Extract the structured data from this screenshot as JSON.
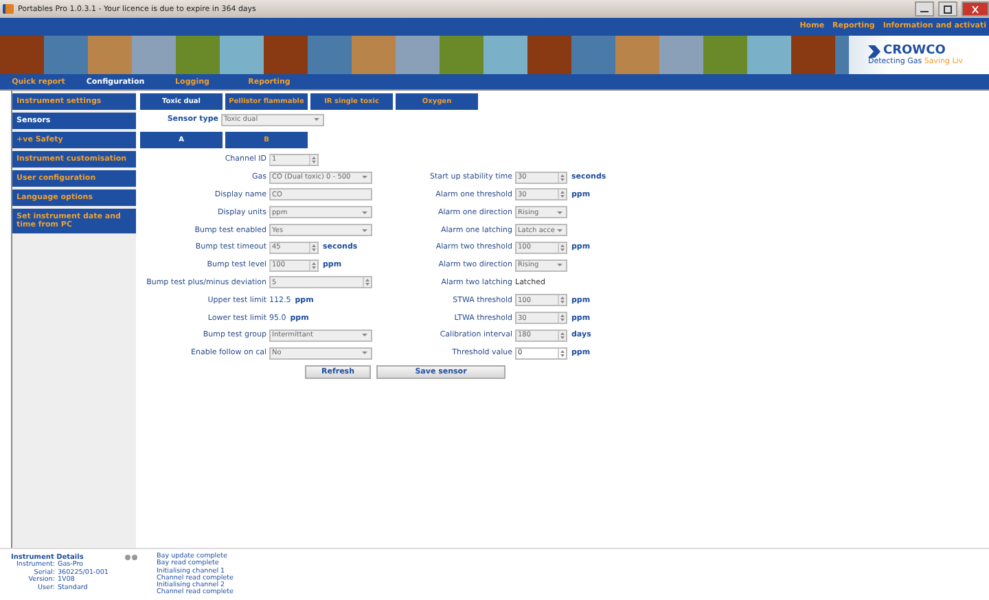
{
  "window": {
    "title": "Portables Pro 1.0.3.1 - Your licence is due to expire in 364 days"
  },
  "top_links": [
    "Home",
    "Reporting",
    "Information and activati"
  ],
  "logo": {
    "name": "CROWCO",
    "tagline_a": "Detecting Gas",
    "tagline_b": "Saving Liv"
  },
  "menu": [
    {
      "label": "Quick report",
      "selected": false
    },
    {
      "label": "Configuration",
      "selected": true
    },
    {
      "label": "Logging",
      "selected": false
    },
    {
      "label": "Reporting",
      "selected": false
    }
  ],
  "sidebar": [
    {
      "label": "Instrument settings",
      "selected": false
    },
    {
      "label": "Sensors",
      "selected": true
    },
    {
      "label": "+ve Safety",
      "selected": false
    },
    {
      "label": "Instrument customisation",
      "selected": false
    },
    {
      "label": "User configuration",
      "selected": false
    },
    {
      "label": "Language options",
      "selected": false
    },
    {
      "label": "Set instrument date and time from PC",
      "selected": false
    }
  ],
  "sensor_tabs": [
    {
      "label": "Toxic dual",
      "selected": true
    },
    {
      "label": "Pellistor flammable",
      "selected": false
    },
    {
      "label": "IR single toxic",
      "selected": false
    },
    {
      "label": "Oxygen",
      "selected": false
    }
  ],
  "sensor_type": {
    "label": "Sensor type",
    "value": "Toxic dual"
  },
  "channel_tabs": [
    {
      "label": "A",
      "selected": true
    },
    {
      "label": "B",
      "selected": false
    }
  ],
  "left_fields": [
    {
      "label": "Channel ID",
      "kind": "spin",
      "value": "1",
      "disabled": true
    },
    {
      "label": "Gas",
      "kind": "select",
      "value": "CO (Dual toxic) 0 - 500",
      "disabled": true
    },
    {
      "label": "Display name",
      "kind": "text",
      "value": "CO",
      "disabled": true
    },
    {
      "label": "Display units",
      "kind": "select",
      "value": "ppm",
      "disabled": true
    },
    {
      "label": "Bump test enabled",
      "kind": "select",
      "value": "Yes",
      "disabled": true
    },
    {
      "label": "Bump test timeout",
      "kind": "spin",
      "value": "45",
      "disabled": true,
      "unit": "seconds"
    },
    {
      "label": "Bump test level",
      "kind": "spin",
      "value": "100",
      "disabled": true,
      "unit": "ppm"
    },
    {
      "label": "Bump test plus/minus deviation",
      "kind": "widespin",
      "value": "5",
      "disabled": true
    },
    {
      "label": "Upper test limit",
      "kind": "static",
      "value": "112.5",
      "unit": "ppm"
    },
    {
      "label": "Lower test limit",
      "kind": "static",
      "value": "95.0",
      "unit": "ppm"
    },
    {
      "label": "Bump test group",
      "kind": "select",
      "value": "Intermittant",
      "disabled": true
    },
    {
      "label": "Enable follow on cal",
      "kind": "select",
      "value": "No",
      "disabled": true
    }
  ],
  "right_fields": [
    {
      "label": "Start up stability time",
      "kind": "spin",
      "value": "30",
      "disabled": true,
      "unit": "seconds"
    },
    {
      "label": "Alarm one threshold",
      "kind": "spin",
      "value": "30",
      "disabled": true,
      "unit": "ppm"
    },
    {
      "label": "Alarm one direction",
      "kind": "select",
      "value": "Rising",
      "disabled": true
    },
    {
      "label": "Alarm one latching",
      "kind": "select",
      "value": "Latch acce",
      "disabled": true
    },
    {
      "label": "Alarm two threshold",
      "kind": "spin",
      "value": "100",
      "disabled": true,
      "unit": "ppm"
    },
    {
      "label": "Alarm two direction",
      "kind": "select",
      "value": "Rising",
      "disabled": true
    },
    {
      "label": "Alarm two latching",
      "kind": "static",
      "value": "Latched"
    },
    {
      "label": "STWA threshold",
      "kind": "spin",
      "value": "100",
      "disabled": true,
      "unit": "ppm"
    },
    {
      "label": "LTWA threshold",
      "kind": "spin",
      "value": "30",
      "disabled": true,
      "unit": "ppm"
    },
    {
      "label": "Calibration interval",
      "kind": "spin",
      "value": "180",
      "disabled": true,
      "unit": "days"
    },
    {
      "label": "Threshold value",
      "kind": "spin",
      "value": "0",
      "disabled": false,
      "unit": "ppm"
    }
  ],
  "buttons": [
    "Refresh",
    "Save sensor"
  ],
  "details": {
    "title": "Instrument Details",
    "rows": [
      {
        "key": "Instrument:",
        "value": "Gas-Pro"
      },
      {
        "key": "Serial:",
        "value": "360225/01-001"
      },
      {
        "key": "Version:",
        "value": "1V08"
      },
      {
        "key": "User:",
        "value": "Standard"
      }
    ]
  },
  "log": [
    "Bay update complete",
    "Bay read complete",
    "Initialising channel 1",
    "Channel read complete",
    "Initialising channel 2",
    "Channel read complete"
  ]
}
